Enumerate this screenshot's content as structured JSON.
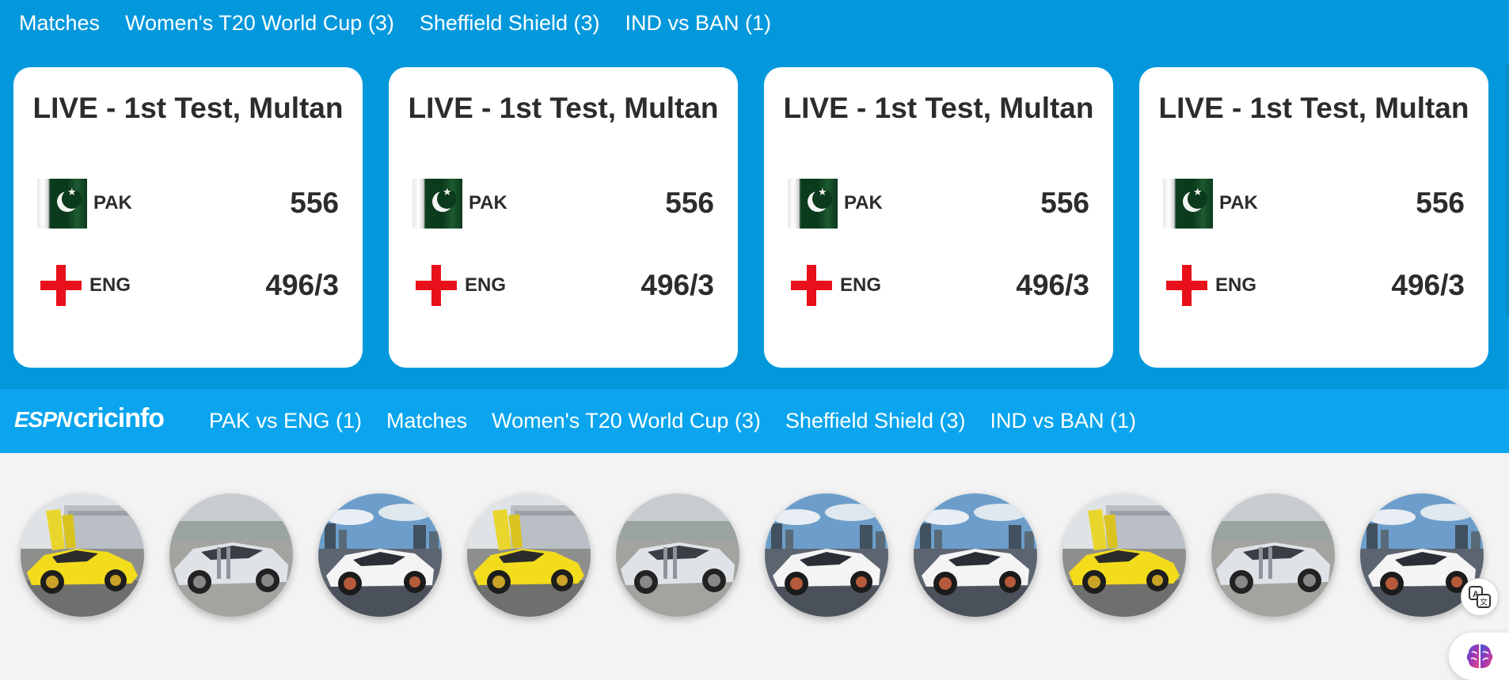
{
  "top_nav": {
    "links": [
      "Matches",
      "Women's T20 World Cup (3)",
      "Sheffield Shield (3)",
      "IND vs BAN (1)"
    ]
  },
  "match_cards": [
    {
      "title": "LIVE - 1st Test, Multan",
      "teams": [
        {
          "name": "PAK",
          "score": "556",
          "flag_icon": "pakistan-flag-icon"
        },
        {
          "name": "ENG",
          "score": "496/3",
          "flag_icon": "england-flag-icon"
        }
      ]
    },
    {
      "title": "LIVE - 1st Test, Multan",
      "teams": [
        {
          "name": "PAK",
          "score": "556",
          "flag_icon": "pakistan-flag-icon"
        },
        {
          "name": "ENG",
          "score": "496/3",
          "flag_icon": "england-flag-icon"
        }
      ]
    },
    {
      "title": "LIVE - 1st Test, Multan",
      "teams": [
        {
          "name": "PAK",
          "score": "556",
          "flag_icon": "pakistan-flag-icon"
        },
        {
          "name": "ENG",
          "score": "496/3",
          "flag_icon": "england-flag-icon"
        }
      ]
    },
    {
      "title": "LIVE - 1st Test, Multan",
      "teams": [
        {
          "name": "PAK",
          "score": "556",
          "flag_icon": "pakistan-flag-icon"
        },
        {
          "name": "ENG",
          "score": "496/3",
          "flag_icon": "england-flag-icon"
        }
      ]
    }
  ],
  "espn_bar": {
    "logo_espn": "ESPN",
    "logo_cricinfo": "cricinfo",
    "links": [
      "PAK vs ENG (1)",
      "Matches",
      "Women's T20 World Cup (3)",
      "Sheffield Shield (3)",
      "IND vs BAN (1)"
    ]
  },
  "car_thumbnails": [
    {
      "kind": "yellow-supercar-doors-up"
    },
    {
      "kind": "silver-roadster"
    },
    {
      "kind": "white-supercar-city"
    },
    {
      "kind": "yellow-supercar-doors-up"
    },
    {
      "kind": "silver-roadster"
    },
    {
      "kind": "white-supercar-city"
    },
    {
      "kind": "white-supercar-city"
    },
    {
      "kind": "yellow-supercar-doors-up"
    },
    {
      "kind": "silver-roadster"
    },
    {
      "kind": "white-supercar-city"
    }
  ],
  "widgets": {
    "translate_icon": "translate-icon",
    "brain_icon": "brain-icon"
  },
  "colors": {
    "top_background": "#0398dc",
    "espn_bar_background": "#0aa5ee",
    "card_background": "#ffffff",
    "page_background": "#f3f3f3",
    "england_cross": "#e8101a",
    "pakistan_green": "#0b3a1c"
  }
}
